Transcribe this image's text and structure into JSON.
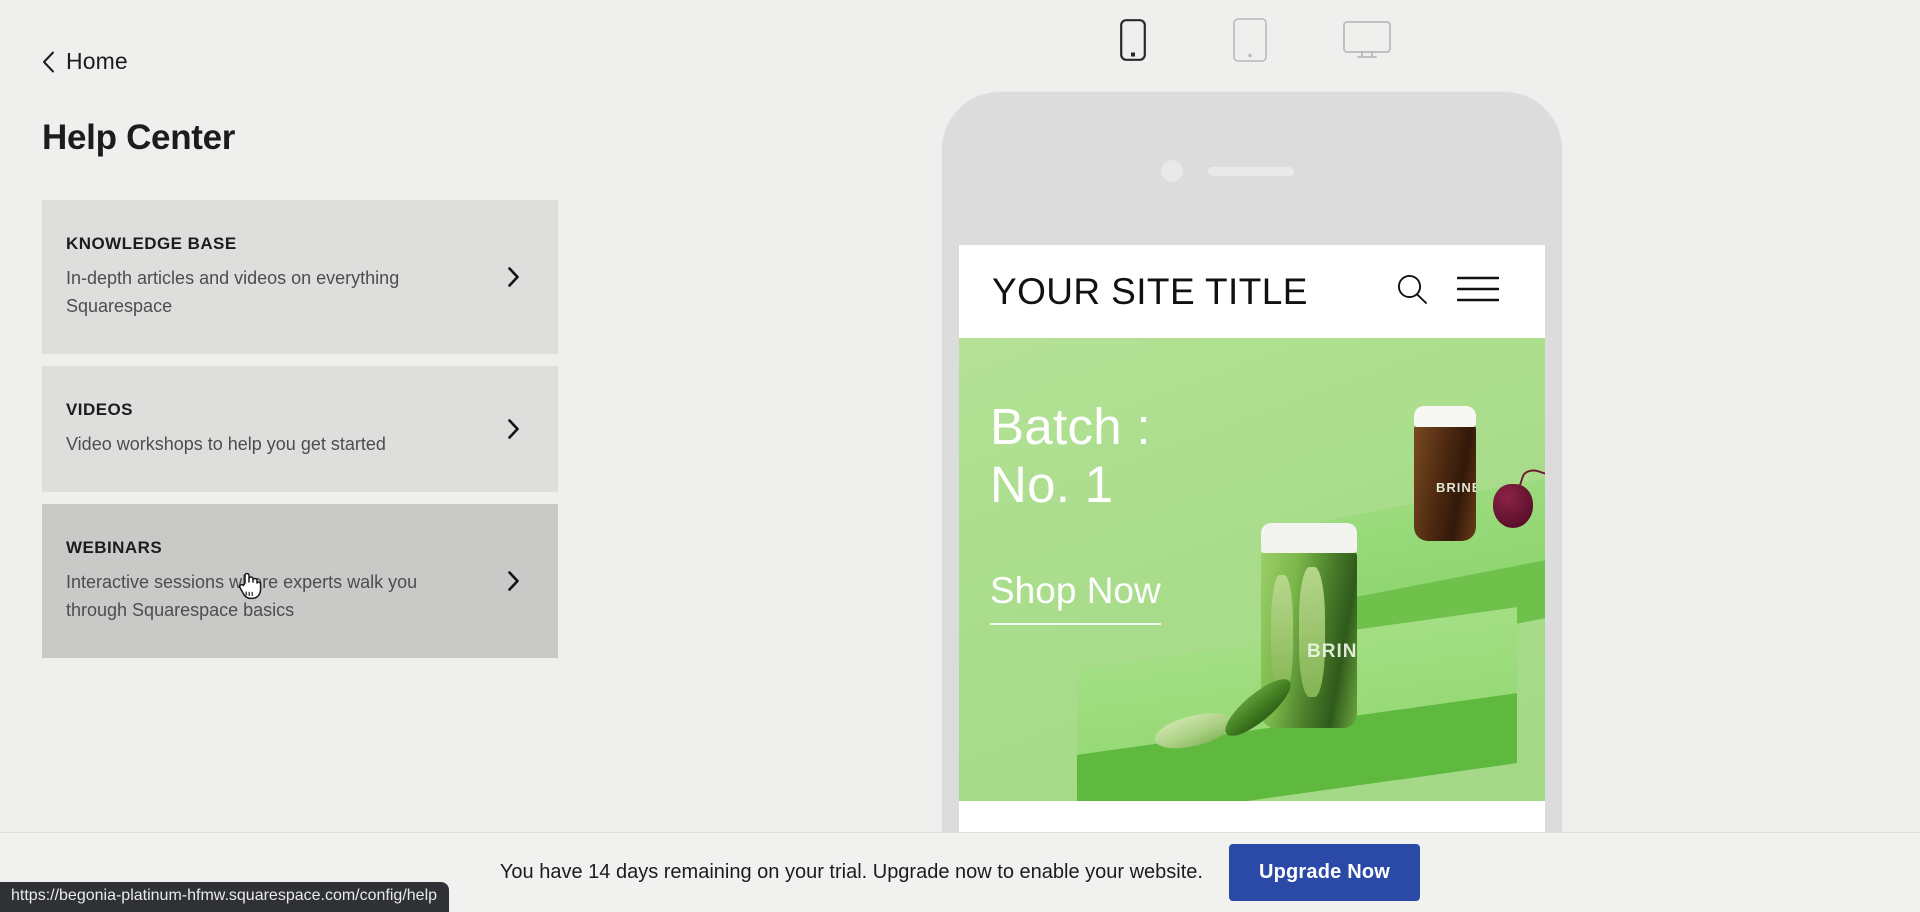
{
  "nav": {
    "back_label": "Home",
    "back_icon": "chevron-left-icon"
  },
  "header": {
    "title": "Help Center"
  },
  "help_cards": [
    {
      "title": "KNOWLEDGE BASE",
      "desc": "In-depth articles and videos on everything Squarespace",
      "chevron_icon": "chevron-right-icon",
      "hovered": false
    },
    {
      "title": "VIDEOS",
      "desc": "Video workshops to help you get started",
      "chevron_icon": "chevron-right-icon",
      "hovered": false
    },
    {
      "title": "WEBINARS",
      "desc": "Interactive sessions where experts walk you through Squarespace basics",
      "chevron_icon": "chevron-right-icon",
      "hovered": true
    }
  ],
  "device_switcher": {
    "options": [
      {
        "name": "mobile-view",
        "icon": "phone-icon",
        "selected": true
      },
      {
        "name": "tablet-view",
        "icon": "tablet-icon",
        "selected": false
      },
      {
        "name": "desktop-view",
        "icon": "desktop-icon",
        "selected": false
      }
    ]
  },
  "preview": {
    "site_title": "YOUR SITE TITLE",
    "search_icon": "search-icon",
    "menu_icon": "hamburger-menu-icon",
    "hero_heading": "Batch :\nNo. 1",
    "hero_cta": "Shop Now",
    "product_label": "BRINE",
    "product_label_small": "BRINE"
  },
  "trial_bar": {
    "message": "You have 14 days remaining on your trial. Upgrade now to enable your website.",
    "button_label": "Upgrade Now",
    "button_color": "#2b4aa8"
  },
  "status": {
    "url": "https://begonia-platinum-hfmw.squarespace.com/config/help"
  },
  "colors": {
    "page_bg": "#efefee",
    "card_bg": "#dededd",
    "card_bg_hover": "#c9c9c8",
    "text_primary": "#1c1c1c",
    "text_secondary": "#4d4d4d",
    "hero_green": "#a9dd8b"
  }
}
